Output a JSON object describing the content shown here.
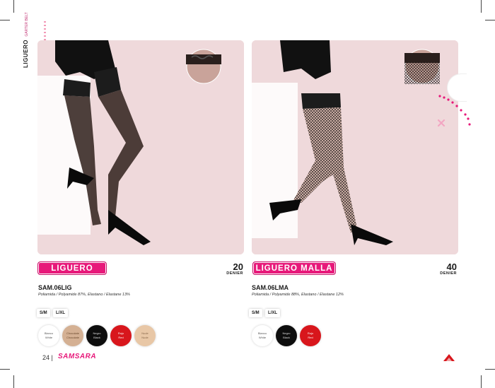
{
  "side": {
    "title": "LIGUERO",
    "subtitle": "GARTER BELT"
  },
  "products": [
    {
      "name": "LIGUERO",
      "denier_value": "20",
      "denier_label": "DENIER",
      "code": "SAM.06LIG",
      "composition": "Poliamida / Polyamide 87%, Elastano / Elastane 13%",
      "sizes": [
        "S/M",
        "L/XL"
      ],
      "colors": [
        {
          "es": "Blanco",
          "en": "White",
          "hex": "#ffffff",
          "text": "#555555"
        },
        {
          "es": "Chocolate",
          "en": "Chocolate",
          "hex": "#d4b093",
          "text": "#6b4a2e"
        },
        {
          "es": "Negro",
          "en": "Black",
          "hex": "#0d0d0d",
          "text": "#dddddd"
        },
        {
          "es": "Rojo",
          "en": "Red",
          "hex": "#d8161c",
          "text": "#ffffff"
        },
        {
          "es": "Nude",
          "en": "Nude",
          "hex": "#e8c7a6",
          "text": "#8a6a4c"
        }
      ]
    },
    {
      "name": "LIGUERO MALLA",
      "denier_value": "40",
      "denier_label": "DENIER",
      "code": "SAM.06LMA",
      "composition": "Poliamida / Polyamide 88%, Elastano / Elastane 12%",
      "sizes": [
        "S/M",
        "L/XL"
      ],
      "colors": [
        {
          "es": "Blanco",
          "en": "White",
          "hex": "#ffffff",
          "text": "#555555"
        },
        {
          "es": "Negro",
          "en": "Black",
          "hex": "#0d0d0d",
          "text": "#dddddd"
        },
        {
          "es": "Rojo",
          "en": "Red",
          "hex": "#d8161c",
          "text": "#ffffff"
        }
      ]
    }
  ],
  "footer": {
    "page": "24",
    "brand": "SAMSARA"
  },
  "colors": {
    "accent": "#e7197a",
    "panel_bg": "#efd9db"
  },
  "icons": [
    "close-icon",
    "brand-badge-icon"
  ]
}
